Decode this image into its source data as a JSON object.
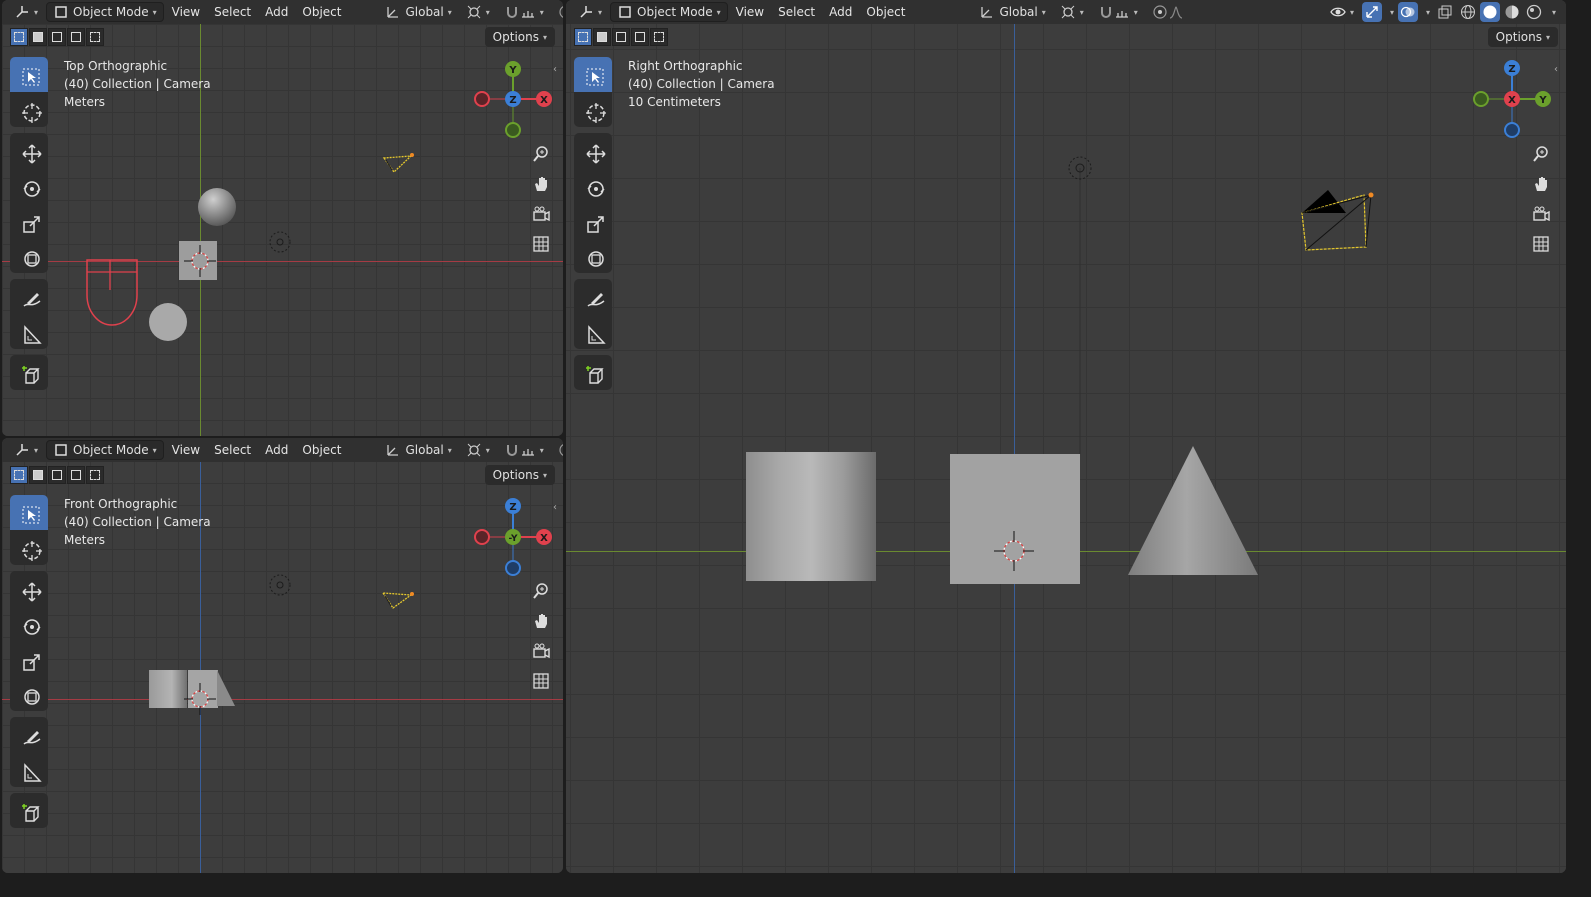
{
  "header": {
    "mode_label": "Object Mode",
    "menus": [
      "View",
      "Select",
      "Add",
      "Object"
    ],
    "orientation": "Global",
    "options_label": "Options"
  },
  "viewports": {
    "top": {
      "view_name": "Top Orthographic",
      "collection": "(40) Collection | Camera",
      "units": "Meters",
      "gizmo": {
        "top": "Y",
        "center": "Z",
        "right": "X"
      }
    },
    "front": {
      "view_name": "Front Orthographic",
      "collection": "(40) Collection | Camera",
      "units": "Meters",
      "gizmo": {
        "top": "Z",
        "center": "-Y",
        "right": "X"
      }
    },
    "right": {
      "view_name": "Right Orthographic",
      "collection": "(40) Collection | Camera",
      "units": "10 Centimeters",
      "gizmo": {
        "top": "Z",
        "center": "X",
        "right": "Y"
      }
    }
  },
  "colors": {
    "x_axis": "#e0414d",
    "y_axis": "#6ba02c",
    "z_axis": "#3b7fd6",
    "active_tool": "#4772b3",
    "selected_outline": "#e5c82e"
  },
  "icons": {
    "tools": [
      "select-box-icon",
      "cursor-icon",
      "move-icon",
      "rotate-icon",
      "scale-icon",
      "transform-icon",
      "annotate-icon",
      "measure-icon",
      "add-cube-icon"
    ],
    "nav": [
      "zoom-icon",
      "hand-pan-icon",
      "camera-view-icon",
      "ortho-grid-icon"
    ]
  }
}
